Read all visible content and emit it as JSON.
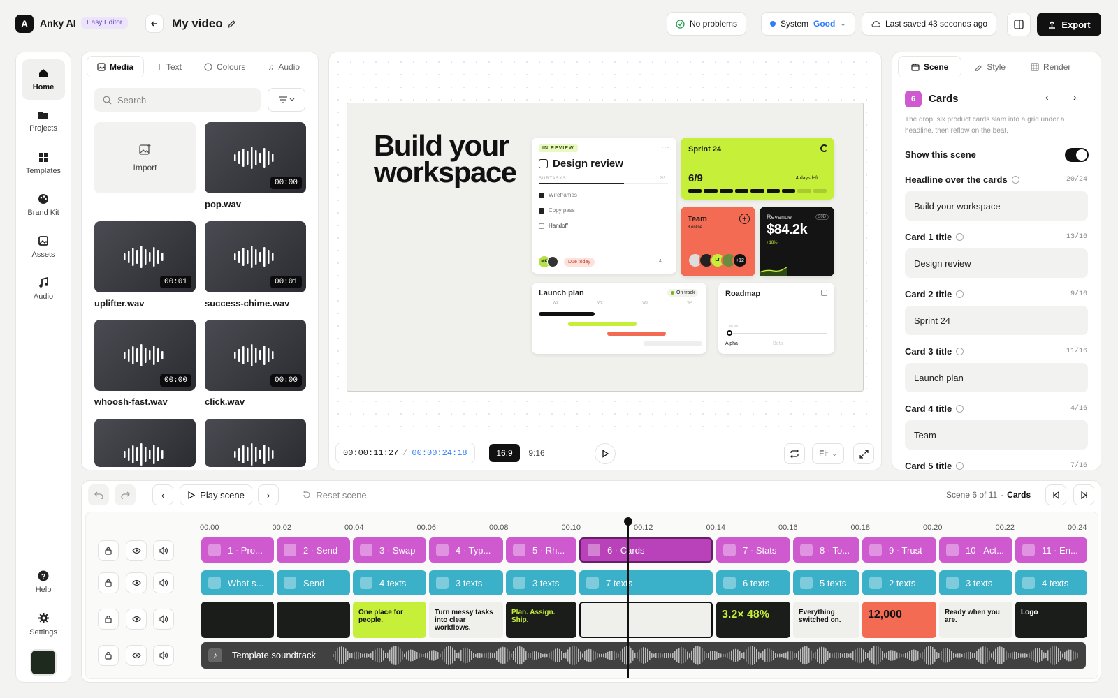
{
  "app": {
    "name": "Anky AI",
    "badge": "Easy Editor",
    "project_title": "My video"
  },
  "topbar": {
    "status_problems": "No problems",
    "system_label": "System",
    "system_status": "Good",
    "saved": "Last saved 43 seconds ago",
    "export": "Export"
  },
  "sidebar": {
    "items": [
      {
        "label": "Home",
        "icon": "home-icon"
      },
      {
        "label": "Projects",
        "icon": "folder-icon"
      },
      {
        "label": "Templates",
        "icon": "grid-icon"
      },
      {
        "label": "Brand Kit",
        "icon": "palette-icon"
      },
      {
        "label": "Assets",
        "icon": "image-icon"
      },
      {
        "label": "Audio",
        "icon": "music-icon"
      }
    ],
    "help": "Help",
    "settings": "Settings"
  },
  "media": {
    "tabs": [
      "Media",
      "Text",
      "Colours",
      "Audio"
    ],
    "search_placeholder": "Search",
    "import_label": "Import",
    "items": [
      {
        "name": "pop.wav",
        "duration": "00:00"
      },
      {
        "name": "uplifter.wav",
        "duration": "00:01"
      },
      {
        "name": "success-chime.wav",
        "duration": "00:01"
      },
      {
        "name": "whoosh-fast.wav",
        "duration": "00:00"
      },
      {
        "name": "click.wav",
        "duration": "00:00"
      }
    ]
  },
  "preview": {
    "headline": "Build your workspace",
    "card1": {
      "tag": "IN REVIEW",
      "title": "Design review",
      "subtasks": "SUBTASKS",
      "count": "2/3",
      "tasks": [
        "Wireframes",
        "Copy pass",
        "Handoff"
      ],
      "due": "Due today",
      "comments": "4",
      "avatar": "MK"
    },
    "card2": {
      "title": "Sprint 24",
      "value": "6/9",
      "note": "4 days left",
      "progress": 0.67
    },
    "card3": {
      "title": "Team",
      "sub": "8 online",
      "more": "+12",
      "initials": "LT"
    },
    "card4": {
      "title": "Revenue",
      "value": "$84.2k",
      "delta": "+18%",
      "tag": "30D"
    },
    "card5": {
      "title": "Launch plan",
      "status": "On track",
      "weeks": [
        "W1",
        "W2",
        "W3",
        "W4"
      ]
    },
    "card6": {
      "title": "Roadmap",
      "left": "Alpha",
      "right": "Beta",
      "q": "NOW"
    }
  },
  "transport": {
    "current": "00:00:11:27",
    "sep": "/",
    "total": "00:00:24:18",
    "ratio_active": "16:9",
    "ratio_other": "9:16",
    "fit": "Fit"
  },
  "inspector": {
    "tabs": [
      "Scene",
      "Style",
      "Render"
    ],
    "scene_number": "6",
    "scene_title": "Cards",
    "description": "The drop: six product cards slam into a grid under a headline, then reflow on the beat.",
    "show_scene": "Show this scene",
    "show_scene_on": true,
    "fields": [
      {
        "label": "Headline over the cards",
        "count": "20/24",
        "value": "Build your workspace"
      },
      {
        "label": "Card 1 title",
        "count": "13/16",
        "value": "Design review"
      },
      {
        "label": "Card 2 title",
        "count": "9/16",
        "value": "Sprint 24"
      },
      {
        "label": "Card 3 title",
        "count": "11/16",
        "value": "Launch plan"
      },
      {
        "label": "Card 4 title",
        "count": "4/16",
        "value": "Team"
      },
      {
        "label": "Card 5 title",
        "count": "7/16",
        "value": ""
      }
    ]
  },
  "timeline": {
    "play_scene": "Play scene",
    "reset_scene": "Reset scene",
    "scene_info": "Scene 6 of 11",
    "scene_sep": "·",
    "scene_name": "Cards",
    "ruler": [
      "00.00",
      "00.02",
      "00.04",
      "00.06",
      "00.08",
      "00.10",
      "00.12",
      "00.14",
      "00.16",
      "00.18",
      "00.20",
      "00.22",
      "00.24"
    ],
    "scenes": [
      "1 · Pro...",
      "2 · Send",
      "3 · Swap",
      "4 · Typ...",
      "5 · Rh...",
      "6 · Cards",
      "7 · Stats",
      "8 · To...",
      "9 · Trust",
      "10 · Act...",
      "11 · En..."
    ],
    "texts": [
      "What s...",
      "Send",
      "4 texts",
      "3 texts",
      "3 texts",
      "7 texts",
      "6 texts",
      "5 texts",
      "2 texts",
      "3 texts",
      "4 texts"
    ],
    "thumbs": [
      "",
      "",
      "One place for people.",
      "Turn messy tasks into clear workflows.",
      "Plan. Assign. Ship.",
      "",
      "3.2× 48%",
      "Everything switched on.",
      "12,000",
      "Ready when you are.",
      "Logo"
    ],
    "soundtrack": "Template soundtrack"
  },
  "colors": {
    "accent_scene": "#cf5acf",
    "accent_text": "#3ab1c8",
    "lime": "#c6ef3a",
    "coral": "#f26b52"
  }
}
